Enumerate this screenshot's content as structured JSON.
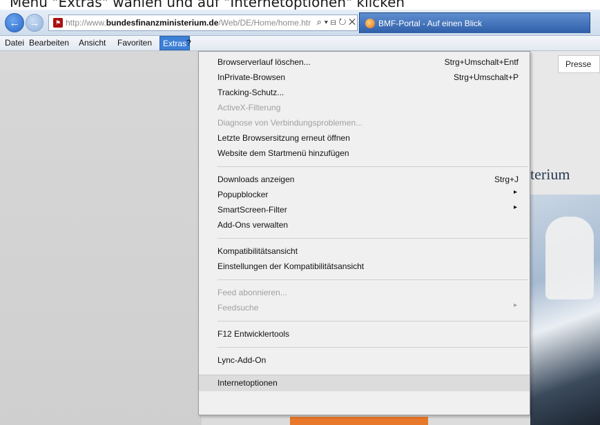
{
  "caption": {
    "text": "Menü \"Extras\" wählen und auf \"Internetoptionen\" klicken"
  },
  "nav": {
    "url_prefix": "http://www.",
    "url_domain": "bundesfinanzministerium.de",
    "url_path": "/Web/DE/Home/home.htr",
    "address_tools": "⌕ ▾ ⊟ ↻ ✕",
    "tab_title": "BMF-Portal - Auf einen Blick"
  },
  "menu_bar": {
    "items": [
      "Datei",
      "Bearbeiten",
      "Ansicht",
      "Favoriten",
      "Extras",
      "?"
    ]
  },
  "page": {
    "presse_label": "Presse",
    "heading_fragment": "terium"
  },
  "dropdown": {
    "items": [
      {
        "label": "Browserverlauf löschen...",
        "shortcut": "Strg+Umschalt+Entf"
      },
      {
        "label": "InPrivate-Browsen",
        "shortcut": "Strg+Umschalt+P"
      },
      {
        "label": "Tracking-Schutz..."
      },
      {
        "label": "ActiveX-Filterung"
      },
      {
        "label": "Diagnose von Verbindungsproblemen..."
      },
      {
        "label": "Letzte Browsersitzung erneut öffnen"
      },
      {
        "label": "Website dem Startmenü hinzufügen"
      },
      {
        "label": "Downloads anzeigen",
        "shortcut": "Strg+J"
      },
      {
        "label": "Popupblocker",
        "arrow": "▸"
      },
      {
        "label": "SmartScreen-Filter",
        "arrow": "▸"
      },
      {
        "label": "Add-Ons verwalten"
      },
      {
        "label": "Kompatibilitätsansicht"
      },
      {
        "label": "Einstellungen der Kompatibilitätsansicht"
      },
      {
        "label": "Feed abonnieren..."
      },
      {
        "label": "Feedsuche",
        "arrow": "▸"
      },
      {
        "label": "F12 Entwicklertools"
      },
      {
        "label": "Lync-Add-On"
      },
      {
        "label": "Internetoptionen"
      }
    ]
  }
}
